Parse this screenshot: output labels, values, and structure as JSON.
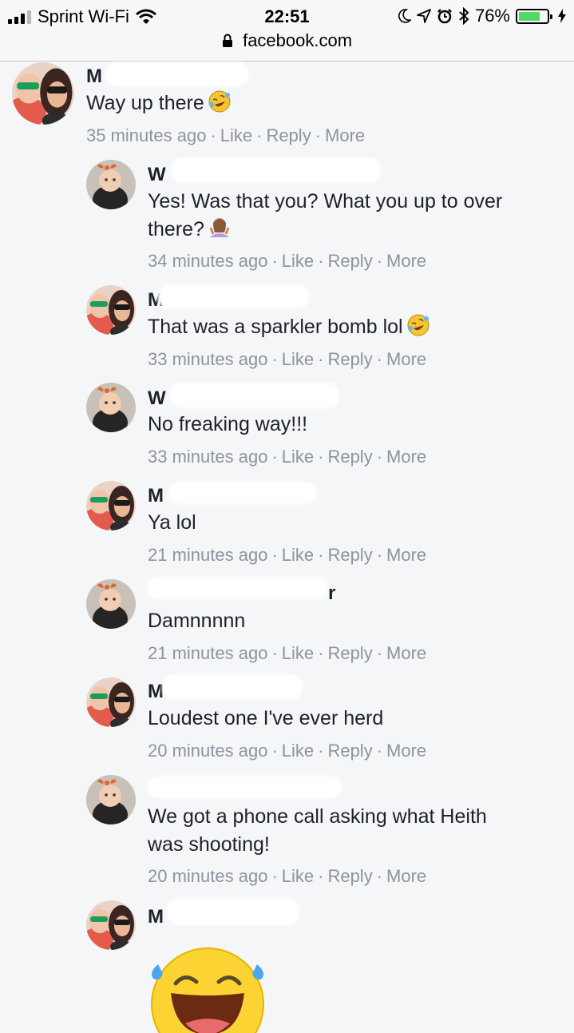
{
  "status_bar": {
    "carrier": "Sprint Wi-Fi",
    "time": "22:51",
    "battery_percent": "76%",
    "battery_level": 0.76,
    "icons": [
      "signal-icon",
      "wifi-icon",
      "moon-icon",
      "location-icon",
      "alarm-icon",
      "bluetooth-icon",
      "battery-icon",
      "charging-icon"
    ]
  },
  "browser": {
    "url": "facebook.com"
  },
  "actions": {
    "like": "Like",
    "reply": "Reply",
    "more": "More",
    "separator": "·"
  },
  "comments": [
    {
      "author_visible": "M",
      "text": "Way up there",
      "emoji": "rofl-emoji",
      "time": "35 minutes ago"
    },
    {
      "author_visible": "W",
      "text_line1": "Yes! Was that you? What you up to over",
      "text_line2": "there?",
      "emoji": "shrug-emoji",
      "time": "34 minutes ago"
    },
    {
      "author_visible": "M",
      "text": "That was a sparkler bomb lol",
      "emoji": "rofl-emoji",
      "time": "33 minutes ago"
    },
    {
      "author_visible": "W",
      "text": "No freaking way!!!",
      "time": "33 minutes ago"
    },
    {
      "author_visible": "M",
      "text": "Ya lol",
      "time": "21 minutes ago"
    },
    {
      "author_visible": "r",
      "text": "Damnnnnn",
      "time": "21 minutes ago"
    },
    {
      "author_visible": "M",
      "text": "Loudest one I've ever herd",
      "time": "20 minutes ago"
    },
    {
      "author_visible": "",
      "text_line1": "We got a phone call asking what Heith",
      "text_line2": "was shooting!",
      "time": "20 minutes ago"
    },
    {
      "author_visible": "M",
      "big_emoji": "laughing-tears-emoji"
    }
  ]
}
